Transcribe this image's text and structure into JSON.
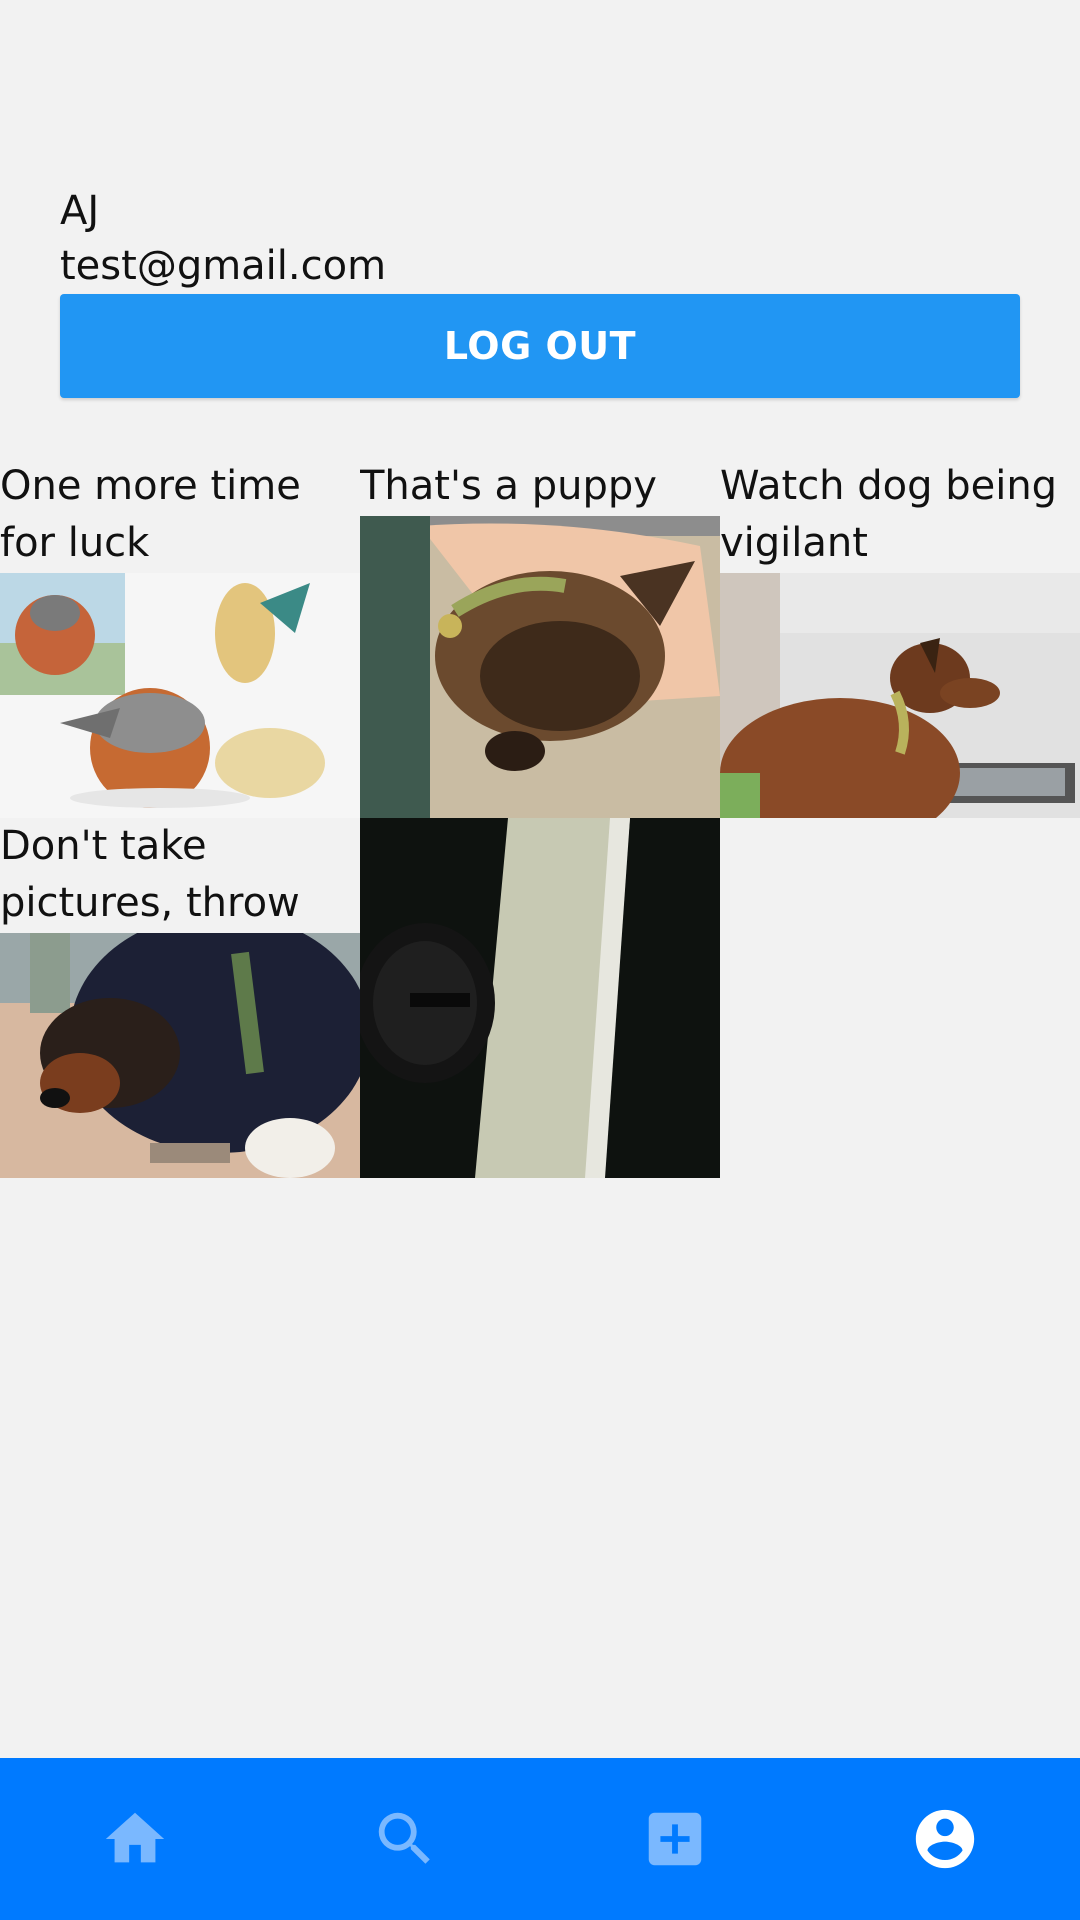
{
  "profile": {
    "name": "AJ",
    "email": "test@gmail.com",
    "logout_label": "LOG OUT"
  },
  "posts": [
    {
      "caption": "One more time for luck",
      "image": "pokemon-artwork"
    },
    {
      "caption": "That's a puppy",
      "image": "dog-sleeping-photo"
    },
    {
      "caption": "Watch dog being vigilant",
      "image": "dog-watching-photo"
    },
    {
      "caption": "Don't take pictures, throw the ball!",
      "image": "dog-outdoors-photo"
    },
    {
      "caption": "",
      "image": "door-lock-photo"
    }
  ],
  "tabs": [
    {
      "icon": "home-icon",
      "active": false
    },
    {
      "icon": "search-icon",
      "active": false
    },
    {
      "icon": "add-post-icon",
      "active": false
    },
    {
      "icon": "account-icon",
      "active": true
    }
  ],
  "colors": {
    "background": "#f2f2f2",
    "logout_button": "#2196f3",
    "tab_bar": "#007aff",
    "tab_icon_inactive": "#7ab8ff",
    "tab_icon_active": "#ffffff"
  }
}
